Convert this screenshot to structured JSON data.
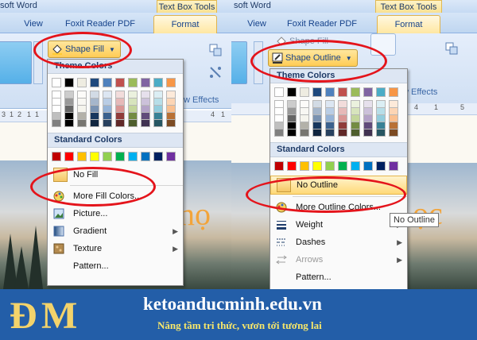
{
  "left": {
    "title": "soft Word",
    "context_tab": "Text Box Tools",
    "tabs": [
      "View",
      "Foxit Reader PDF",
      "Format"
    ],
    "shape_button": "Shape Fill",
    "group_label": "w Effects",
    "ruler": [
      "3",
      "1",
      "2",
      "1",
      "1",
      "4",
      "1"
    ],
    "menu": {
      "theme_header": "Theme Colors",
      "standard_header": "Standard Colors",
      "items": [
        {
          "label": "No Fill",
          "icon": "no-fill-swatch-icon",
          "highlight": false
        },
        {
          "label": "More Fill Colors...",
          "icon": "color-palette-icon"
        },
        {
          "label": "Picture...",
          "icon": "picture-icon"
        },
        {
          "label": "Gradient",
          "icon": "gradient-icon",
          "submenu": true
        },
        {
          "label": "Texture",
          "icon": "texture-icon",
          "submenu": true
        },
        {
          "label": "Pattern...",
          "icon": "pattern-icon"
        }
      ]
    },
    "doc_ghost_text": "nọ"
  },
  "right": {
    "title": "soft Word",
    "context_tab": "Text Box Tools",
    "tabs": [
      "View",
      "Foxit Reader PDF",
      "Format"
    ],
    "shape_fill_faded": "Shape Fill",
    "shape_button": "Shape Outline",
    "group_label": "w Effects",
    "ruler": [
      "4",
      "1",
      "5"
    ],
    "menu": {
      "theme_header": "Theme Colors",
      "standard_header": "Standard Colors",
      "items": [
        {
          "label": "No Outline",
          "icon": "no-outline-swatch-icon",
          "highlight": true
        },
        {
          "label": "More Outline Colors...",
          "icon": "color-palette-icon"
        },
        {
          "label": "Weight",
          "icon": "line-weight-icon",
          "submenu": true
        },
        {
          "label": "Dashes",
          "icon": "dashes-icon",
          "submenu": true
        },
        {
          "label": "Arrows",
          "icon": "arrows-icon",
          "submenu": true,
          "disabled": true
        },
        {
          "label": "Pattern...",
          "icon": "pattern-icon"
        }
      ]
    },
    "tooltip": "No Outline",
    "doc_ghost_text": "ọc"
  },
  "colors": {
    "theme_top": [
      "#ffffff",
      "#000000",
      "#eeece1",
      "#1f497d",
      "#4f81bd",
      "#c0504d",
      "#9bbb59",
      "#8064a2",
      "#4bacc6",
      "#f79646"
    ],
    "standard": [
      "#c00000",
      "#ff0000",
      "#ffc000",
      "#ffff00",
      "#92d050",
      "#00b050",
      "#00b0f0",
      "#0070c0",
      "#002060",
      "#7030a0"
    ],
    "annotation_ring": "#e4141b",
    "banner_bg": "#235ea8"
  },
  "banner": {
    "site": "ketoanducminh.edu.vn",
    "slogan": "Nâng tầm tri thức, vươn tới tương lai"
  }
}
